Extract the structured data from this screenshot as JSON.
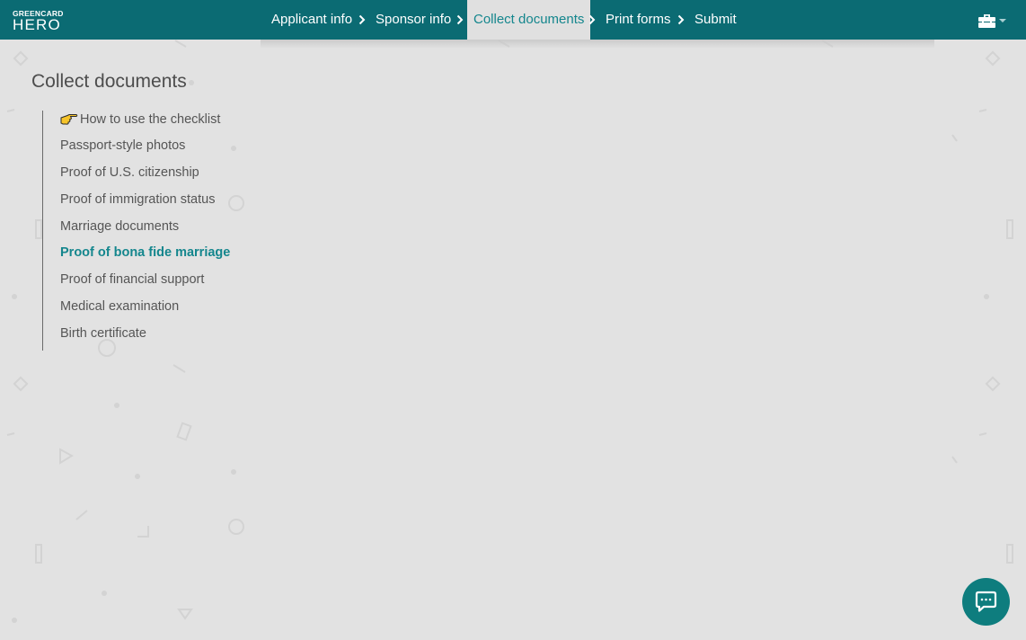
{
  "brand": {
    "logo_top": "GREENCARD",
    "logo_bottom": "HERO"
  },
  "steps": [
    {
      "label": "Applicant info",
      "active": false
    },
    {
      "label": "Sponsor info",
      "active": false
    },
    {
      "label": "Collect documents",
      "active": true
    },
    {
      "label": "Print forms",
      "active": false
    },
    {
      "label": "Submit",
      "active": false
    }
  ],
  "toolbox": {
    "icon": "toolbox-icon",
    "dropdown_icon": "caret-down-icon"
  },
  "page": {
    "title": "Collect documents"
  },
  "checklist": {
    "items": [
      {
        "label": "How to use the checklist",
        "icon": "pointing-hand-icon",
        "current": false
      },
      {
        "label": "Passport-style photos",
        "current": false
      },
      {
        "label": "Proof of U.S. citizenship",
        "current": false
      },
      {
        "label": "Proof of immigration status",
        "current": false
      },
      {
        "label": "Marriage documents",
        "current": false
      },
      {
        "label": "Proof of bona fide marriage",
        "current": true
      },
      {
        "label": "Proof of financial support",
        "current": false
      },
      {
        "label": "Medical examination",
        "current": false
      },
      {
        "label": "Birth certificate",
        "current": false
      }
    ]
  },
  "chat": {
    "icon": "chat-bubble-icon"
  },
  "colors": {
    "nav_background": "#0b6b73",
    "accent": "#14868d",
    "page_background": "#e2e2e2",
    "chat_button": "#0e7d7e"
  }
}
